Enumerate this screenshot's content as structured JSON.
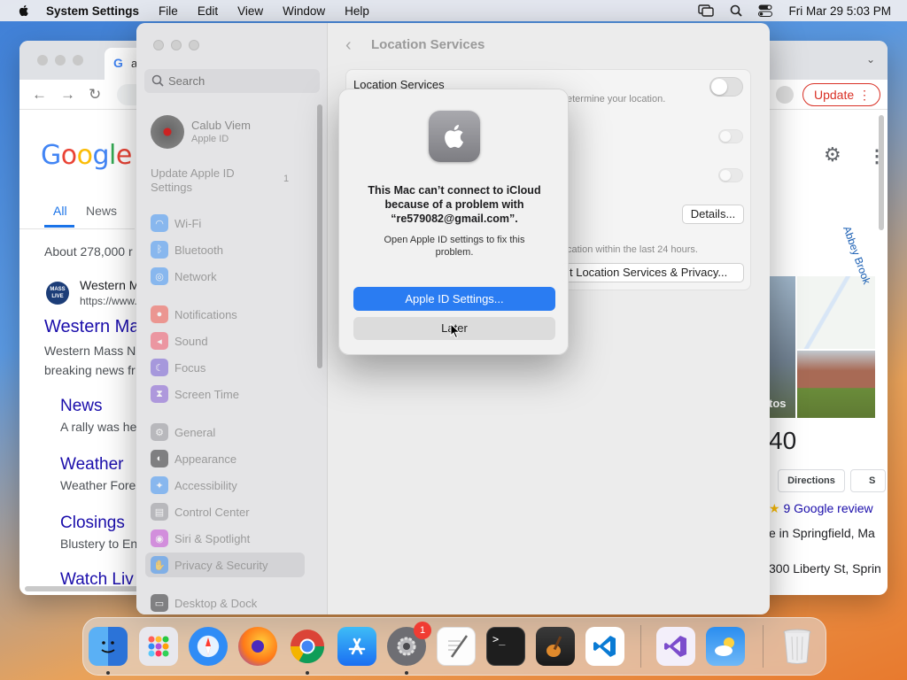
{
  "menubar": {
    "app_name": "System Settings",
    "menus": [
      "File",
      "Edit",
      "View",
      "Window",
      "Help"
    ],
    "datetime": "Fri Mar 29  5:03 PM"
  },
  "chrome": {
    "tab_title": "a",
    "update_label": "Update",
    "google": {
      "tabs": [
        "All",
        "News"
      ],
      "about": "About 278,000 r",
      "site_name": "Western M",
      "site_url": "https://www.",
      "site_logo_text": "MASS LIVE",
      "result_title": "Western Ma",
      "snippet_line1": "Western Mass N",
      "snippet_line2": "breaking news fr",
      "sublinks": [
        {
          "title": "News",
          "desc": "A rally was he"
        },
        {
          "title": "Weather",
          "desc": "Weather Fore"
        },
        {
          "title": "Closings",
          "desc": "Blustery to En"
        },
        {
          "title": "Watch Liv",
          "desc": ""
        }
      ]
    },
    "knowledge_panel": {
      "map_label": "Abbey Brook",
      "photos_label": "tos",
      "big_number": "40",
      "directions_label": "Directions",
      "save_label": "S",
      "reviews": "9 Google review",
      "line1": "e in Springfield, Ma",
      "line2": "300 Liberty St, Sprin"
    }
  },
  "settings": {
    "search_placeholder": "Search",
    "account": {
      "name": "Calub Viem",
      "sub": "Apple ID"
    },
    "update_apple_id": "Update Apple ID Settings",
    "update_badge": "1",
    "sidebar_items": [
      {
        "label": "Wi-Fi",
        "color": "#2f8cf6"
      },
      {
        "label": "Bluetooth",
        "color": "#2f8cf6"
      },
      {
        "label": "Network",
        "color": "#2f8cf6"
      },
      {
        "label": "Notifications",
        "color": "#f24b3f"
      },
      {
        "label": "Sound",
        "color": "#f24b5e"
      },
      {
        "label": "Focus",
        "color": "#6a4fd4"
      },
      {
        "label": "Screen Time",
        "color": "#7a4fd4"
      },
      {
        "label": "General",
        "color": "#8e8e93"
      },
      {
        "label": "Appearance",
        "color": "#1c1c1e"
      },
      {
        "label": "Accessibility",
        "color": "#2f8cf6"
      },
      {
        "label": "Control Center",
        "color": "#8e8e93"
      },
      {
        "label": "Siri & Spotlight",
        "color": "#c23bd4"
      },
      {
        "label": "Privacy & Security",
        "color": "#2f8cf6"
      },
      {
        "label": "Desktop & Dock",
        "color": "#1c1c1e"
      }
    ],
    "selected_item": "Privacy & Security",
    "page_title": "Location Services",
    "location_services_label": "Location Services",
    "location_services_desc": "etermine your location.",
    "details_label": "Details...",
    "note": "cation within the last 24 hours.",
    "about_label": "t Location Services & Privacy..."
  },
  "alert": {
    "title": "This Mac can’t connect to iCloud because of a problem with “re579082@gmail.com”.",
    "message": "Open Apple ID settings to fix this problem.",
    "primary_button": "Apple ID Settings...",
    "secondary_button": "Later",
    "accent": "#2a7cf2"
  },
  "dock": {
    "apps": [
      "Finder",
      "Launchpad",
      "Safari",
      "Firefox",
      "Chrome",
      "App Store",
      "System Settings",
      "TextEdit",
      "Terminal",
      "GarageBand",
      "VS Code",
      "Visual Studio",
      "Weather",
      "Trash"
    ],
    "settings_badge": "1"
  }
}
